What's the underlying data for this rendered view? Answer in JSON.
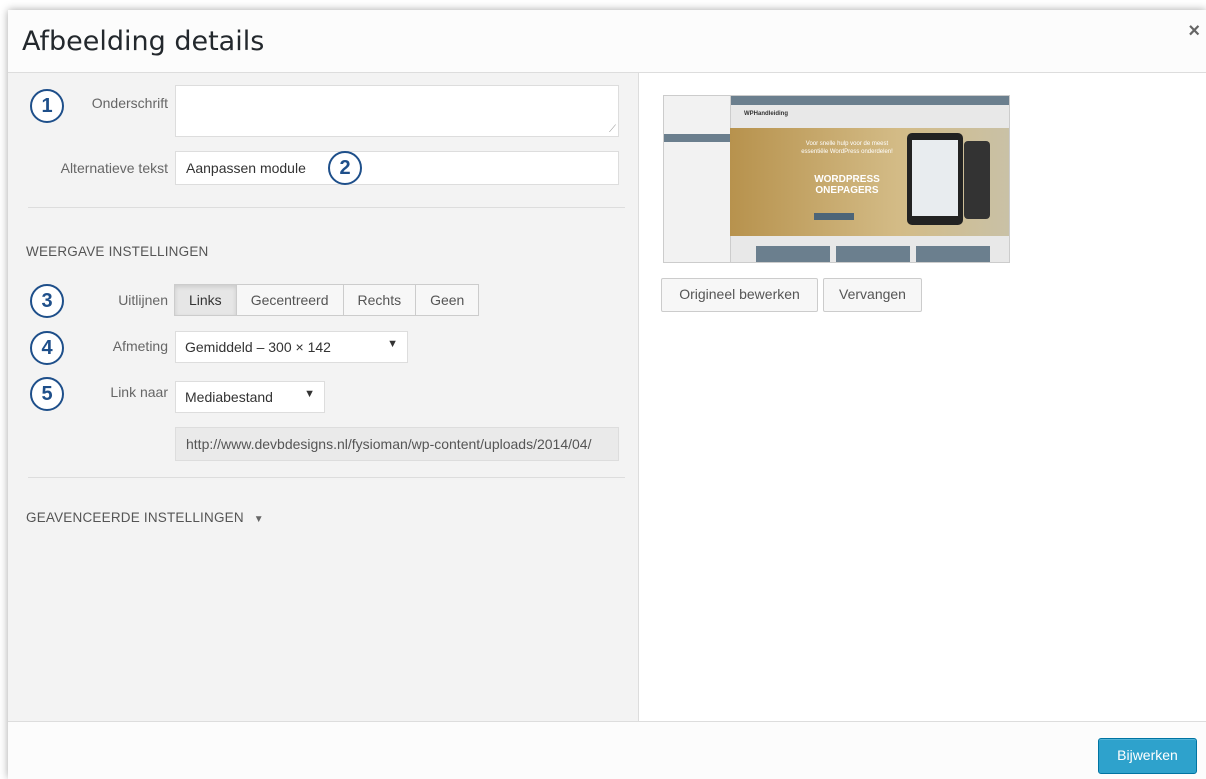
{
  "modal": {
    "title": "Afbeelding details",
    "close_label": "×"
  },
  "badges": [
    "1",
    "2",
    "3",
    "4",
    "5"
  ],
  "fields": {
    "caption_label": "Onderschrift",
    "caption_value": "",
    "alt_label": "Alternatieve tekst",
    "alt_value": "Aanpassen module"
  },
  "display": {
    "heading": "WEERGAVE INSTELLINGEN",
    "align_label": "Uitlijnen",
    "align_options": [
      "Links",
      "Gecentreerd",
      "Rechts",
      "Geen"
    ],
    "align_selected": "Links",
    "size_label": "Afmeting",
    "size_value": "Gemiddeld – 300 × 142",
    "link_label": "Link naar",
    "link_value": "Mediabestand",
    "url_value": "http://www.devbdesigns.nl/fysioman/wp-content/uploads/2014/04/"
  },
  "advanced": {
    "heading": "GEAVENCEERDE INSTELLINGEN",
    "arrow": "▼"
  },
  "preview": {
    "brand": "WPHandleiding",
    "headline": "WORDPRESS ONEPAGERS",
    "tagline": "Voor snelle hulp voor de meest essentiële WordPress onderdelen!"
  },
  "actions": {
    "edit_label": "Origineel bewerken",
    "replace_label": "Vervangen",
    "update_label": "Bijwerken"
  },
  "colors": {
    "accent": "#2ea2cc",
    "badge": "#1e4f8a"
  }
}
